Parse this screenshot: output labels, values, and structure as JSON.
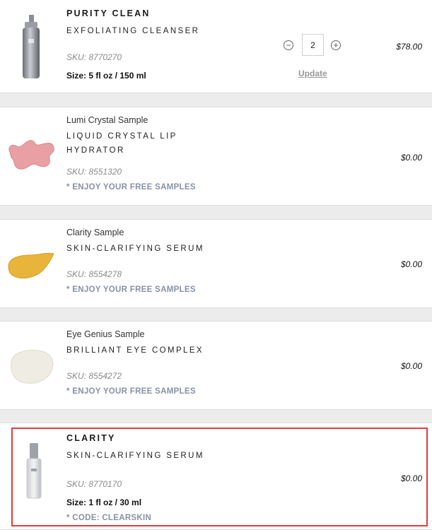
{
  "items": [
    {
      "brand": "PURITY CLEAN",
      "name": "EXFOLIATING CLEANSER",
      "sku": "SKU: 8770270",
      "size": "Size: 5 fl oz / 150 ml",
      "price": "$78.00",
      "quantity": "2",
      "update_label": "Update",
      "image": "pump-bottle"
    },
    {
      "sample_label": "Lumi Crystal Sample",
      "name_line1": "LIQUID CRYSTAL LIP",
      "name_line2": "HYDRATOR",
      "sku": "SKU: 8551320",
      "promo": "* ENJOY YOUR FREE SAMPLES",
      "price": "$0.00",
      "image": "pink-swatch"
    },
    {
      "sample_label": "Clarity Sample",
      "name": "SKIN-CLARIFYING SERUM",
      "sku": "SKU: 8554278",
      "promo": "* ENJOY YOUR FREE SAMPLES",
      "price": "$0.00",
      "image": "amber-swatch"
    },
    {
      "sample_label": "Eye Genius Sample",
      "name": "BRILLIANT EYE COMPLEX",
      "sku": "SKU: 8554272",
      "promo": "* ENJOY YOUR FREE SAMPLES",
      "price": "$0.00",
      "image": "cream-swatch"
    },
    {
      "brand": "CLARITY",
      "name": "SKIN-CLARIFYING SERUM",
      "sku": "SKU: 8770170",
      "size": "Size: 1 fl oz / 30 ml",
      "promo": "* CODE: CLEARSKIN",
      "price": "$0.00",
      "image": "serum-bottle"
    }
  ],
  "icons": {
    "decrease": "minus-circle-icon",
    "increase": "plus-circle-icon"
  },
  "colors": {
    "highlight": "#e53a3a",
    "promo": "#8792a6",
    "separator": "#ececec"
  }
}
